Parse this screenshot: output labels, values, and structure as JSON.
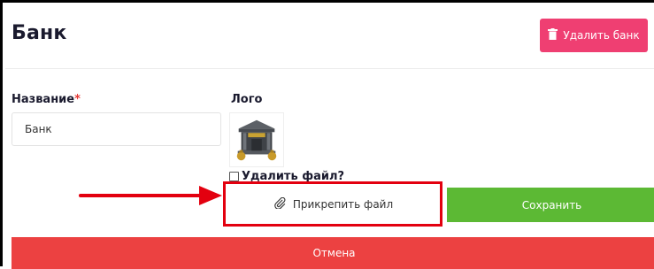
{
  "header": {
    "title": "Банк",
    "delete_bank_label": "Удалить банк"
  },
  "form": {
    "name_label": "Название",
    "name_required_mark": "*",
    "name_value": "Банк",
    "logo_label": "Лого",
    "delete_file_label": "Удалить файл?",
    "attach_file_label": "Прикрепить файл",
    "save_label": "Сохранить",
    "cancel_label": "Отмена"
  },
  "colors": {
    "delete_button": "#ef3f72",
    "save_button": "#5cb934",
    "cancel_button": "#ec4141",
    "annotation": "#e3000f"
  },
  "icons": [
    "trash-icon",
    "paperclip-icon",
    "bank-logo-image"
  ]
}
